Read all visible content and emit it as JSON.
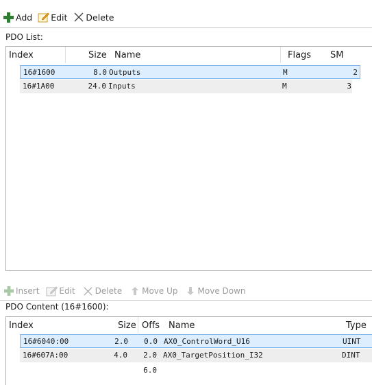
{
  "pdo_toolbar": {
    "add_label": "Add",
    "edit_label": "Edit",
    "delete_label": "Delete"
  },
  "pdo_list": {
    "title": "PDO List:",
    "columns": {
      "index": "Index",
      "size": "Size",
      "name": "Name",
      "flags": "Flags",
      "sm": "SM"
    },
    "rows": [
      {
        "index": "16#1600",
        "size": "8.0",
        "name": "Outputs",
        "flags": "M",
        "sm": "2",
        "selected": true
      },
      {
        "index": "16#1A00",
        "size": "24.0",
        "name": "Inputs",
        "flags": "M",
        "sm": "3",
        "selected": false
      }
    ]
  },
  "content_toolbar": {
    "insert_label": "Insert",
    "edit_label": "Edit",
    "delete_label": "Delete",
    "move_up_label": "Move Up",
    "move_down_label": "Move Down"
  },
  "pdo_content": {
    "title": "PDO Content (16#1600):",
    "columns": {
      "index": "Index",
      "size": "Size",
      "offs": "Offs",
      "name": "Name",
      "type": "Type"
    },
    "rows": [
      {
        "index": "16#6040:00",
        "size": "2.0",
        "offs": "0.0",
        "name": "AX0_ControlWord_U16",
        "type": "UINT",
        "selected": true
      },
      {
        "index": "16#607A:00",
        "size": "4.0",
        "offs": "2.0",
        "name": "AX0_TargetPosition_I32",
        "type": "DINT",
        "selected": false
      }
    ],
    "total_offset": "6.0"
  },
  "colors": {
    "selection_bg": "#ddeeff",
    "selection_border": "#7eb4ea",
    "add_icon": "#2e7d32",
    "edit_icon": "#f0a020"
  },
  "icons": [
    "add-icon",
    "edit-icon",
    "delete-icon",
    "insert-icon",
    "move-up-icon",
    "move-down-icon"
  ]
}
